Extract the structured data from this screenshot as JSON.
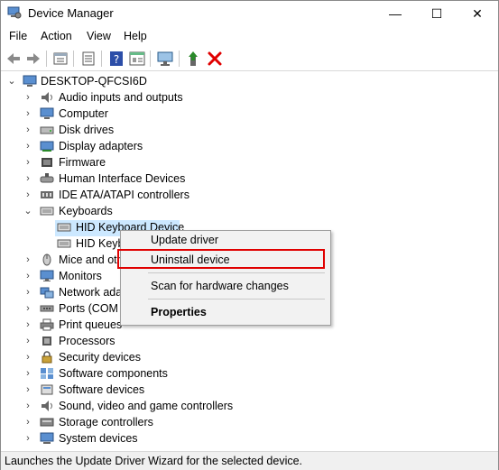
{
  "window": {
    "title": "Device Manager",
    "min_glyph": "—",
    "max_glyph": "☐",
    "close_glyph": "✕"
  },
  "menu": [
    "File",
    "Action",
    "View",
    "Help"
  ],
  "toolbar": [
    "back-icon",
    "forward-icon",
    "properties-icon",
    "update-driver-icon",
    "help-icon",
    "properties-sheet-icon",
    "scan-hardware-icon",
    "enable-device-icon",
    "uninstall-device-icon"
  ],
  "tree": {
    "root": "DESKTOP-QFCSI6D",
    "items": [
      {
        "label": "Audio inputs and outputs",
        "icon": "audio-icon"
      },
      {
        "label": "Computer",
        "icon": "computer-icon"
      },
      {
        "label": "Disk drives",
        "icon": "disk-drive-icon"
      },
      {
        "label": "Display adapters",
        "icon": "display-adapter-icon"
      },
      {
        "label": "Firmware",
        "icon": "firmware-icon"
      },
      {
        "label": "Human Interface Devices",
        "icon": "hid-icon"
      },
      {
        "label": "IDE ATA/ATAPI controllers",
        "icon": "ide-controller-icon"
      },
      {
        "label": "Keyboards",
        "icon": "keyboard-icon",
        "expanded": true
      },
      {
        "label": "HID Keyboard Device",
        "icon": "keyboard-icon",
        "child": true,
        "selected": true
      },
      {
        "label": "HID Keyb",
        "icon": "keyboard-icon",
        "child": true
      },
      {
        "label": "Mice and oth",
        "icon": "mouse-icon"
      },
      {
        "label": "Monitors",
        "icon": "monitor-icon"
      },
      {
        "label": "Network ada",
        "icon": "network-adapter-icon"
      },
      {
        "label": "Ports (COM &",
        "icon": "ports-icon"
      },
      {
        "label": "Print queues",
        "icon": "printer-icon"
      },
      {
        "label": "Processors",
        "icon": "processor-icon"
      },
      {
        "label": "Security devices",
        "icon": "security-icon"
      },
      {
        "label": "Software components",
        "icon": "software-components-icon"
      },
      {
        "label": "Software devices",
        "icon": "software-devices-icon"
      },
      {
        "label": "Sound, video and game controllers",
        "icon": "sound-icon"
      },
      {
        "label": "Storage controllers",
        "icon": "storage-icon"
      },
      {
        "label": "System devices",
        "icon": "system-devices-icon"
      }
    ]
  },
  "context_menu": {
    "update_driver": "Update driver",
    "uninstall_device": "Uninstall device",
    "scan_hardware": "Scan for hardware changes",
    "properties": "Properties"
  },
  "status": "Launches the Update Driver Wizard for the selected device.",
  "colors": {
    "selection": "#cce8ff",
    "highlight_box": "#e00000",
    "uninstall": "#e00000",
    "enable": "#2a8a2a"
  }
}
